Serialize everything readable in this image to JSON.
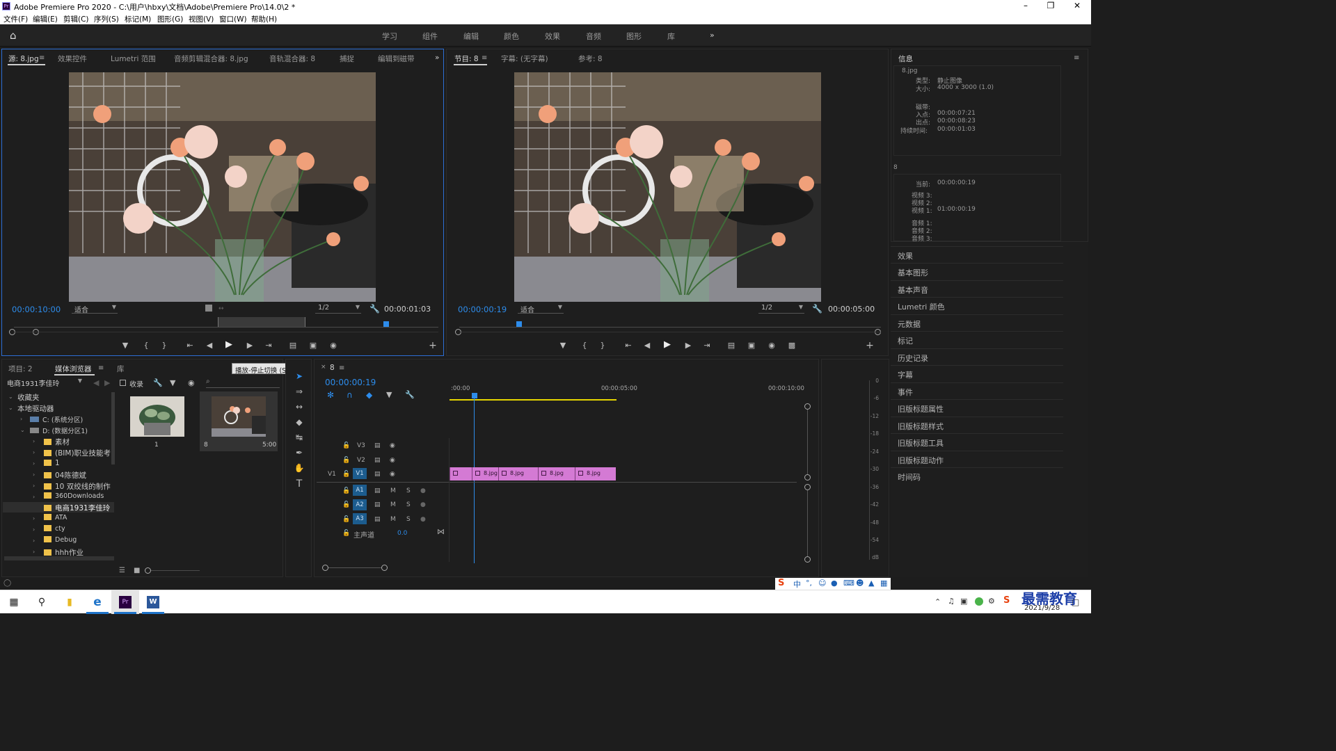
{
  "window": {
    "title": "Adobe Premiere Pro 2020 - C:\\用户\\hbxy\\文档\\Adobe\\Premiere Pro\\14.0\\2 *",
    "app_icon": "Pr"
  },
  "menu": [
    "文件(F)",
    "编辑(E)",
    "剪辑(C)",
    "序列(S)",
    "标记(M)",
    "图形(G)",
    "视图(V)",
    "窗口(W)",
    "帮助(H)"
  ],
  "workspaces": [
    "学习",
    "组件",
    "编辑",
    "颜色",
    "效果",
    "音频",
    "图形",
    "库"
  ],
  "source": {
    "tabs": [
      "源: 8.jpg",
      "效果控件",
      "Lumetri 范围",
      "音频剪辑混合器: 8.jpg",
      "音轨混合器: 8",
      "捕捉",
      "编辑到磁带"
    ],
    "timecode_in": "00:00:10:00",
    "fit": "适合",
    "res": "1/2",
    "duration": "00:00:01:03"
  },
  "program": {
    "tabs": [
      "节目: 8",
      "字幕: (无字幕)",
      "参考: 8"
    ],
    "timecode": "00:00:00:19",
    "fit": "适合",
    "res": "1/2",
    "duration": "00:00:05:00"
  },
  "info_panel": {
    "title": "信息",
    "file": "8.jpg",
    "type_label": "类型:",
    "type_value": "静止图像",
    "size_label": "大小:",
    "size_value": "4000 x 3000 (1.0)",
    "clip_label": "磁带:",
    "in_label": "入点:",
    "in_value": "00:00:07:21",
    "out_label": "出点:",
    "out_value": "00:00:08:23",
    "dur_label": "持续时间:",
    "dur_value": "00:00:01:03",
    "seq": "8",
    "cur_label": "当前:",
    "cur_value": "00:00:00:19",
    "v3": "视频 3:",
    "v2": "视频 2:",
    "v1": "视频 1:",
    "v1_value": "01:00:00:19",
    "a1": "音频 1:",
    "a2": "音频 2:",
    "a3": "音频 3:"
  },
  "right_panels": [
    "效果",
    "基本图形",
    "基本声音",
    "Lumetri 颜色",
    "元数据",
    "标记",
    "历史记录",
    "字幕",
    "事件",
    "旧版标题属性",
    "旧版标题样式",
    "旧版标题工具",
    "旧版标题动作",
    "时间码"
  ],
  "project": {
    "tabs": [
      "项目: 2",
      "媒体浏览器",
      "库"
    ],
    "location": "电商1931李佳玲",
    "ingest": "收录",
    "tooltip": "播放-停止切换 (Space)",
    "tree": [
      {
        "label": "收藏夹",
        "level": 0,
        "folder": false
      },
      {
        "label": "本地驱动器",
        "level": 0,
        "folder": false
      },
      {
        "label": "C: (系统分区)",
        "level": 1,
        "folder": false
      },
      {
        "label": "D: (数据分区1)",
        "level": 1,
        "folder": false
      },
      {
        "label": "素材",
        "level": 2,
        "folder": true
      },
      {
        "label": "(BIM)职业技能考",
        "level": 2,
        "folder": true
      },
      {
        "label": "1",
        "level": 2,
        "folder": true
      },
      {
        "label": "04陈德斌",
        "level": 2,
        "folder": true
      },
      {
        "label": "10 双绞线的制作",
        "level": 2,
        "folder": true
      },
      {
        "label": "360Downloads",
        "level": 2,
        "folder": true
      },
      {
        "label": "电商1931李佳玲",
        "level": 2,
        "folder": true
      },
      {
        "label": "ATA",
        "level": 2,
        "folder": true
      },
      {
        "label": "cty",
        "level": 2,
        "folder": true
      },
      {
        "label": "Debug",
        "level": 2,
        "folder": true
      },
      {
        "label": "hhh作业",
        "level": 2,
        "folder": true
      }
    ],
    "thumbs": [
      {
        "name": "1",
        "dur": ""
      },
      {
        "name": "8",
        "dur": "5:00"
      }
    ]
  },
  "timeline": {
    "seq_tab": "8",
    "timecode": "00:00:00:19",
    "ruler": [
      ":00:00",
      "00:00:05:00",
      "00:00:10:00"
    ],
    "video_tracks": [
      "V3",
      "V2",
      "V1"
    ],
    "audio_tracks": [
      "A1",
      "A2",
      "A3"
    ],
    "master": "主声道",
    "master_value": "0.0",
    "v1_src": "V1",
    "clip_label": "8.jpg",
    "meter_ticks": [
      "0",
      "-6",
      "-12",
      "-18",
      "-24",
      "-30",
      "-36",
      "-42",
      "-48",
      "-54",
      "dB"
    ],
    "m": "M",
    "s": "S"
  },
  "taskbar": {
    "date": "2021/9/28",
    "watermark": "最需教育",
    "ime": "中"
  }
}
